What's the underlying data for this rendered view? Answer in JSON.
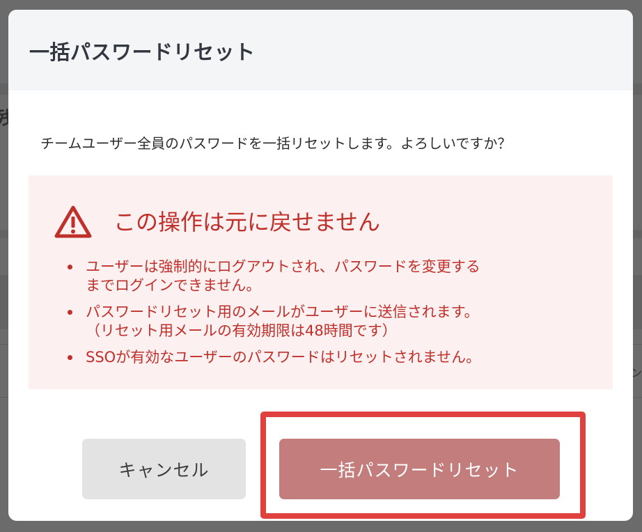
{
  "modal": {
    "title": "一括パスワードリセット",
    "message": "チームユーザー全員のパスワードを一括リセットします。よろしいですか？"
  },
  "warning": {
    "icon": "warning-triangle-icon",
    "title": "この操作は元に戻せません",
    "items": [
      {
        "line1": "ユーザーは強制的にログアウトされ、パスワードを変更する",
        "line2": "までログインできません。"
      },
      {
        "line1": "パスワードリセット用のメールがユーザーに送信されます。",
        "line2": "（リセット用メールの有効期限は48時間です）"
      },
      {
        "line1": "SSOが有効なユーザーのパスワードはリセットされません。",
        "line2": ""
      }
    ]
  },
  "buttons": {
    "cancel": "キャンセル",
    "confirm": "一括パスワードリセット"
  },
  "background": {
    "glyph_a": "残",
    "glyph_b": "ン"
  },
  "colors": {
    "warning_text": "#c0302b",
    "warning_bg": "#fcf0f0",
    "confirm_button": "#c47d7d",
    "highlight": "#e0413f"
  }
}
